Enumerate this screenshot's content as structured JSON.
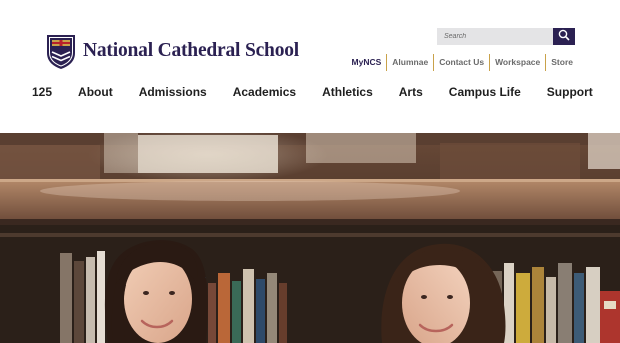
{
  "brand": {
    "school_name": "National Cathedral School",
    "logo_icon": "shield-crest-icon",
    "primary_color": "#2b2152",
    "accent_color": "#c9a24a"
  },
  "search": {
    "placeholder": "Search",
    "button_icon": "search-icon"
  },
  "utility_nav": {
    "items": [
      {
        "label": "MyNCS"
      },
      {
        "label": "Alumnae"
      },
      {
        "label": "Contact Us"
      },
      {
        "label": "Workspace"
      },
      {
        "label": "Store"
      }
    ]
  },
  "main_nav": {
    "items": [
      {
        "label": "125"
      },
      {
        "label": "About"
      },
      {
        "label": "Admissions"
      },
      {
        "label": "Academics"
      },
      {
        "label": "Athletics"
      },
      {
        "label": "Arts"
      },
      {
        "label": "Campus Life"
      },
      {
        "label": "Support"
      }
    ]
  }
}
